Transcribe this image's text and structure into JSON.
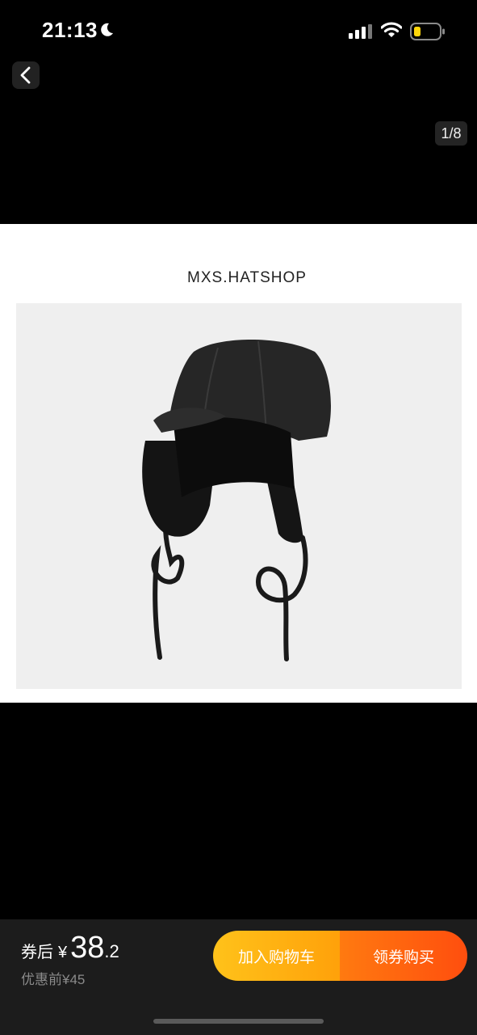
{
  "status_bar": {
    "time": "21:13",
    "icons": [
      "moon-icon",
      "signal-icon",
      "wifi-icon",
      "battery-icon"
    ],
    "battery_color": "#ffd60a"
  },
  "header": {
    "back_icon": "chevron-left-icon",
    "image_counter": "1/8"
  },
  "product_image": {
    "brand": "MXS.HATSHOP"
  },
  "purchase_bar": {
    "price_prefix": "券后",
    "currency": "¥",
    "price_integer": "38",
    "price_decimal": ".2",
    "original_price": "优惠前¥45",
    "add_to_cart_label": "加入购物车",
    "buy_label": "领券购买",
    "cart_color": "#ffb414",
    "buy_color": "#ff5e0f"
  }
}
